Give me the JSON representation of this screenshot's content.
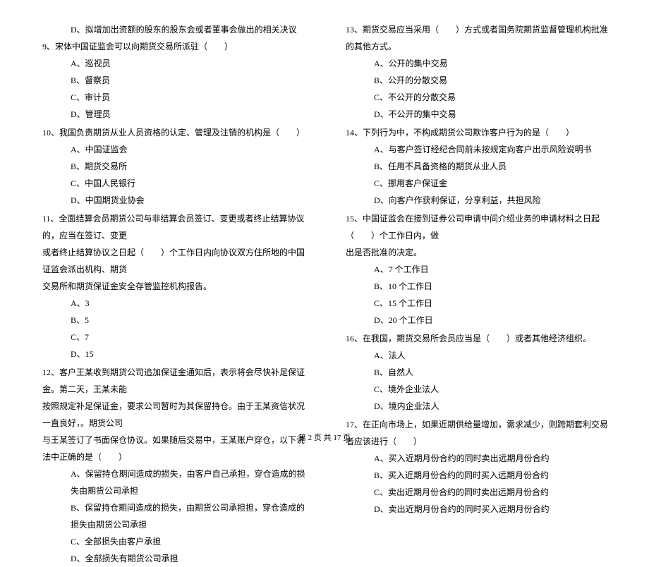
{
  "leftColumn": {
    "q8_option_d": "D、拟增加出资额的股东的股东会或者董事会做出的相关决议",
    "q9": {
      "text": "9、宋体中国证监会可以向期货交易所派驻（　　）",
      "a": "A、巡视员",
      "b": "B、督察员",
      "c": "C、审计员",
      "d": "D、管理员"
    },
    "q10": {
      "text": "10、我国负责期货从业人员资格的认定、管理及注销的机构是（　　）",
      "a": "A、中国证监会",
      "b": "B、期货交易所",
      "c": "C、中国人民银行",
      "d": "D、中国期货业协会"
    },
    "q11": {
      "line1": "11、全面结算会员期货公司与非结算会员签订、变更或者终止结算协议的，应当在签订、变更",
      "line2": "或者终止结算协议之日起（　　）个工作日内向协议双方住所地的中国证监会派出机构、期货",
      "line3": "交易所和期货保证金安全存管监控机构报告。",
      "a": "A、3",
      "b": "B、5",
      "c": "C、7",
      "d": "D、15"
    },
    "q12": {
      "line1": "12、客户王某收到期货公司追加保证金通知后，表示将会尽快补足保证金。第二天，王某未能",
      "line2": "按照规定补足保证金，要求公司暂时为其保留持仓。由于王某资信状况一直良好，。期货公司",
      "line3": "与王某签订了书面保仓协议。如果随后交易中，王某账户穿仓，以下说法中正确的是（　　）",
      "a": "A、保留持仓期间造成的损失，由客户自己承担，穿仓造成的损失由期货公司承担",
      "b": "B、保留持仓期间造成的损失，由期货公司承担担，穿仓造成的损失由期货公司承担",
      "c": "C、全部损失由客户承担",
      "d": "D、全部损失有期货公司承担"
    }
  },
  "rightColumn": {
    "q13": {
      "text": "13、期货交易应当采用（　　）方式或者国务院期货监督管理机构批准的其他方式。",
      "a": "A、公开的集中交易",
      "b": "B、公开的分散交易",
      "c": "C、不公开的分散交易",
      "d": "D、不公开的集中交易"
    },
    "q14": {
      "text": "14、下列行为中，不构成期货公司欺诈客户行为的是（　　）",
      "a": "A、与客户签订经纪合同前未按规定向客户出示风险说明书",
      "b": "B、任用不具备资格的期货从业人员",
      "c": "C、挪用客户保证金",
      "d": "D、向客户作获利保证，分享利益，共担风险"
    },
    "q15": {
      "line1": "15、中国证监会在接到证券公司申请中间介绍业务的申请材料之日起（　　）个工作日内，做",
      "line2": "出是否批准的决定。",
      "a": "A、7 个工作日",
      "b": "B、10 个工作日",
      "c": "C、15 个工作日",
      "d": "D、20 个工作日"
    },
    "q16": {
      "text": "16、在我国，期货交易所会员应当是（　　）或者其他经济组织。",
      "a": "A、法人",
      "b": "B、自然人",
      "c": "C、境外企业法人",
      "d": "D、境内企业法人"
    },
    "q17": {
      "text": "17、在正向市场上，如果近期供给量增加，需求减少，则跨期套利交易者应该进行（　　）",
      "a": "A、买入近期月份合约的同时卖出远期月份合约",
      "b": "B、买入近期月份合约的同时买入远期月份合约",
      "c": "C、卖出近期月份合约的同时卖出远期月份合约",
      "d": "D、卖出近期月份合约的同时买入远期月份合约"
    }
  },
  "pageNumber": "第 2 页 共 17 页"
}
